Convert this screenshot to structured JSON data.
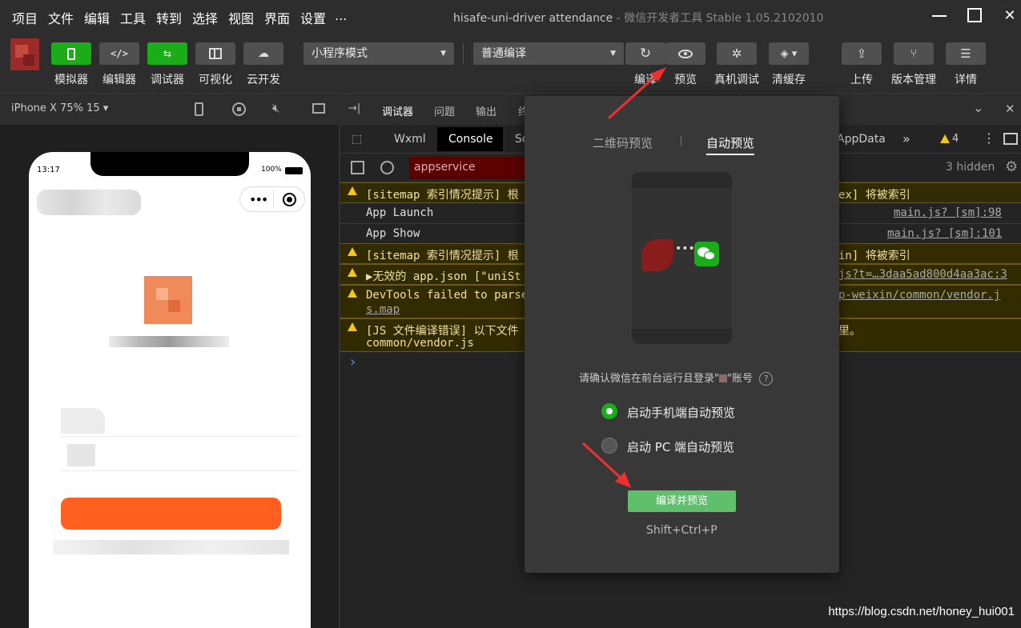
{
  "menu": [
    "项目",
    "文件",
    "编辑",
    "工具",
    "转到",
    "选择",
    "视图",
    "界面",
    "设置",
    "..."
  ],
  "window_title": {
    "main": "hisafe-uni-driver attendance",
    "sub": "- 微信开发者工具 Stable 1.05.2102010"
  },
  "toolbar": {
    "left_buttons": [
      {
        "label": "模拟器",
        "icon": "phone-icon"
      },
      {
        "label": "编辑器",
        "icon": "code-icon"
      },
      {
        "label": "调试器",
        "icon": "debugger-icon"
      },
      {
        "label": "可视化",
        "icon": "layout-icon"
      },
      {
        "label": "云开发",
        "icon": "cloud-icon"
      }
    ],
    "mode_select": "小程序模式",
    "compile_select": "普通编译",
    "right_buttons": [
      {
        "label": "编译",
        "icon": "refresh-icon"
      },
      {
        "label": "预览",
        "icon": "eye-icon"
      },
      {
        "label": "真机调试",
        "icon": "bug-icon"
      },
      {
        "label": "清缓存",
        "icon": "layers-icon"
      },
      {
        "label": "上传",
        "icon": "upload-icon"
      },
      {
        "label": "版本管理",
        "icon": "branch-icon"
      },
      {
        "label": "详情",
        "icon": "menu-icon"
      }
    ]
  },
  "simulator": {
    "device": "iPhone X 75% 15",
    "caret": "▾",
    "time": "13:17",
    "battery": "100%"
  },
  "devtools": {
    "tabs": [
      "调试器",
      "问题",
      "输出",
      "终"
    ],
    "subtabs": [
      "Wxml",
      "Console",
      "So",
      "AppData",
      "»"
    ],
    "warn_count": "4",
    "filter_context": "appservice",
    "hidden_count": "3 hidden",
    "rows": [
      {
        "type": "warn",
        "text": "[sitemap 索引情况提示] 根",
        "tail": "ex] 将被索引"
      },
      {
        "type": "info",
        "text": "App Launch",
        "link": "main.js? [sm]:98"
      },
      {
        "type": "info",
        "text": "App Show",
        "link": "main.js? [sm]:101"
      },
      {
        "type": "warn",
        "text": "[sitemap 索引情况提示] 根",
        "tail": "in] 将被索引"
      },
      {
        "type": "warn",
        "text": "▶无效的 app.json [\"uniSt",
        "link": "js?t=…3daa5ad800d4aa3ac:3"
      },
      {
        "type": "warn",
        "text": "DevTools failed to parse",
        "link": "p-weixin/common/vendor.j",
        "line2": "s.map"
      },
      {
        "type": "warn",
        "text": "[JS 文件编译错误] 以下文件",
        "tail": "里。",
        "line2": "common/vendor.js"
      }
    ],
    "prompt": "›"
  },
  "popup": {
    "tabs": [
      "二维码预览",
      "自动预览"
    ],
    "confirm_text": "请确认微信在前台运行且登录\"",
    "confirm_tail": "\"账号",
    "help": "?",
    "options": [
      {
        "label": "启动手机端自动预览",
        "checked": true
      },
      {
        "label": "启动 PC 端自动预览",
        "checked": false
      }
    ],
    "button": "编译并预览",
    "shortcut": "Shift+Ctrl+P"
  },
  "watermark": "https://blog.csdn.net/honey_hui001",
  "colors": {
    "green": "#1aad19",
    "arrow": "#f03030",
    "warn": "#f5c518"
  }
}
